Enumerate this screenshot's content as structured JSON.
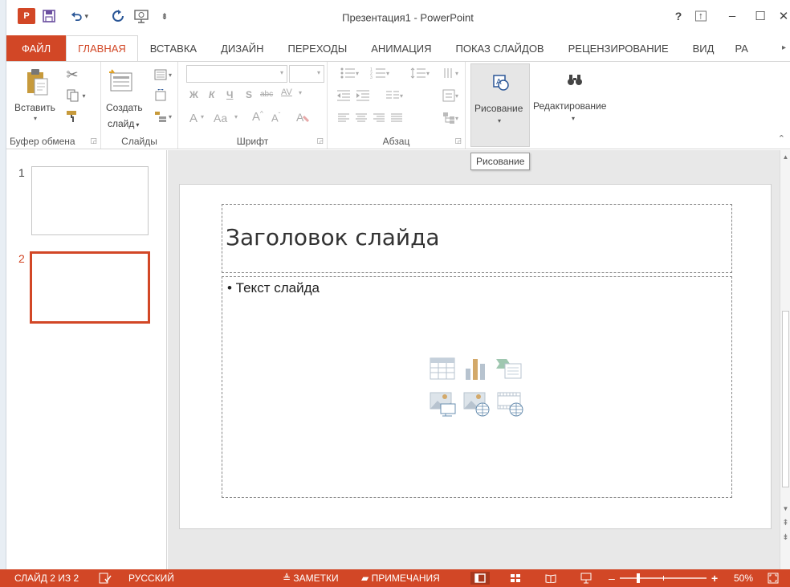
{
  "window": {
    "title": "Презентация1 - PowerPoint",
    "help": "?",
    "minimize": "–",
    "maximize": "☐",
    "close": "✕"
  },
  "qat": {
    "logo": "P",
    "undo_arrow": "▾",
    "more": "⇟"
  },
  "tabs": [
    {
      "label": "ФАЙЛ"
    },
    {
      "label": "ГЛАВНАЯ"
    },
    {
      "label": "ВСТАВКА"
    },
    {
      "label": "ДИЗАЙН"
    },
    {
      "label": "ПЕРЕХОДЫ"
    },
    {
      "label": "АНИМАЦИЯ"
    },
    {
      "label": "ПОКАЗ СЛАЙДОВ"
    },
    {
      "label": "РЕЦЕНЗИРОВАНИЕ"
    },
    {
      "label": "ВИД"
    },
    {
      "label": "РА"
    }
  ],
  "ribbon": {
    "clipboard": {
      "paste_label": "Вставить",
      "group_label": "Буфер обмена"
    },
    "slides": {
      "new_slide_line1": "Создать",
      "new_slide_line2": "слайд",
      "group_label": "Слайды"
    },
    "font": {
      "bold": "Ж",
      "italic": "К",
      "underline": "Ч",
      "shadow": "S",
      "strike": "abc",
      "spacing": "AV",
      "grow": "A",
      "shrink": "A",
      "case": "Aa",
      "clear": "A",
      "group_label": "Шрифт"
    },
    "paragraph": {
      "group_label": "Абзац"
    },
    "drawing": {
      "label": "Рисование"
    },
    "editing": {
      "label": "Редактирование"
    }
  },
  "tooltip": {
    "text": "Рисование"
  },
  "slides_pane": {
    "thumbs": [
      {
        "number": "1"
      },
      {
        "number": "2"
      }
    ]
  },
  "slide": {
    "title": "Заголовок слайда",
    "body": "• Текст слайда"
  },
  "status": {
    "slide_counter": "СЛАЙД 2 ИЗ 2",
    "language": "РУССКИЙ",
    "notes": "ЗАМЕТКИ",
    "comments": "ПРИМЕЧАНИЯ",
    "zoom_minus": "–",
    "zoom_plus": "+",
    "zoom_percent": "50%",
    "zoom_level": 0.5
  },
  "colors": {
    "accent": "#d24726",
    "ribbon_bg": "#ffffff",
    "edit_area_bg": "#e8e8e8"
  }
}
